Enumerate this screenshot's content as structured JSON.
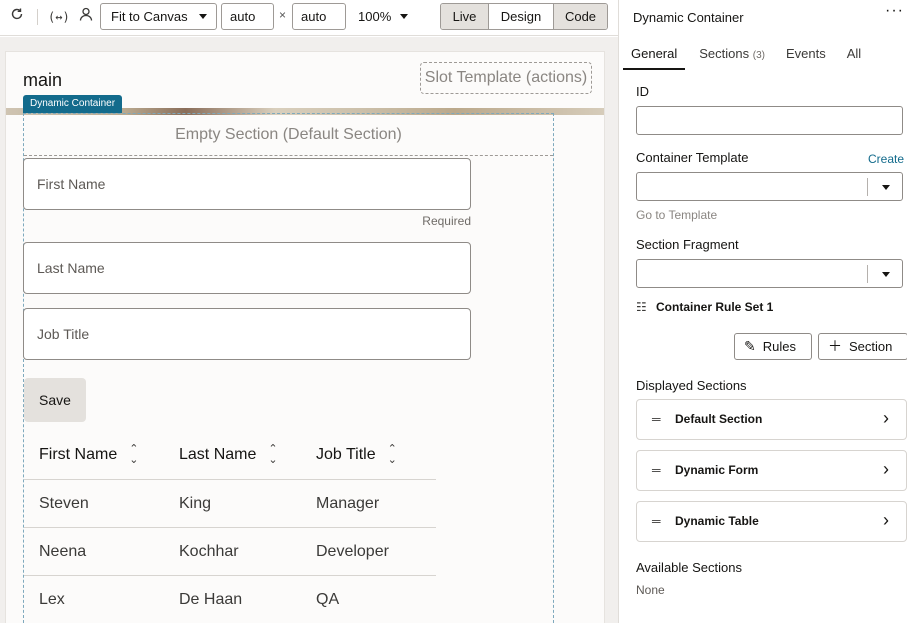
{
  "toolbar": {
    "fit_select": "Fit to Canvas",
    "width_value": "auto",
    "height_value": "auto",
    "times_symbol": "×",
    "zoom": "100%",
    "modes": [
      "Live",
      "Design",
      "Code"
    ],
    "icons": [
      "refresh-icon",
      "variables-icon",
      "user-icon"
    ]
  },
  "canvas": {
    "page_title": "main",
    "slot_template": "Slot Template (actions)",
    "badge": "Dynamic Container",
    "empty_section": "Empty Section (Default Section)",
    "fields": [
      {
        "placeholder": "First Name"
      },
      {
        "placeholder": "Last Name"
      },
      {
        "placeholder": "Job Title"
      }
    ],
    "required_hint": "Required",
    "save_label": "Save",
    "table": {
      "headers": [
        "First Name",
        "Last Name",
        "Job Title"
      ],
      "rows": [
        [
          "Steven",
          "King",
          "Manager"
        ],
        [
          "Neena",
          "Kochhar",
          "Developer"
        ],
        [
          "Lex",
          "De Haan",
          "QA"
        ]
      ]
    }
  },
  "panel": {
    "title": "Dynamic Container",
    "more": "···",
    "tabs": [
      {
        "label": "General"
      },
      {
        "label": "Sections",
        "count": "(3)"
      },
      {
        "label": "Events"
      },
      {
        "label": "All"
      }
    ],
    "id_label": "ID",
    "container_template_label": "Container Template",
    "create_link": "Create",
    "go_to_template": "Go to Template",
    "section_fragment_label": "Section Fragment",
    "rule_set": "Container Rule Set 1",
    "rules_button": "Rules",
    "section_button": "Section",
    "displayed_sections_label": "Displayed Sections",
    "displayed_sections": [
      "Default Section",
      "Dynamic Form",
      "Dynamic Table"
    ],
    "available_sections_label": "Available Sections",
    "available_sections_value": "None"
  },
  "colors": {
    "badge": "#136b8c",
    "link": "#136b8c",
    "canvas_bg": "#f1efed"
  }
}
